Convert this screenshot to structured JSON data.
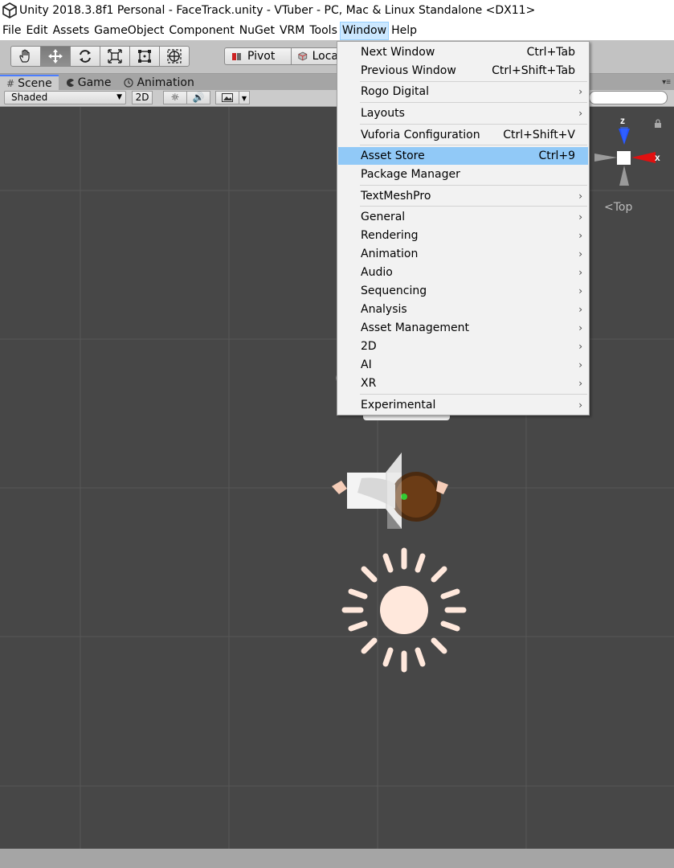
{
  "window": {
    "title": "Unity 2018.3.8f1 Personal - FaceTrack.unity - VTuber - PC, Mac & Linux Standalone <DX11>"
  },
  "menubar": {
    "items": [
      "File",
      "Edit",
      "Assets",
      "GameObject",
      "Component",
      "NuGet",
      "VRM",
      "Tools",
      "Window",
      "Help"
    ],
    "active": "Window"
  },
  "toolbar": {
    "tools": [
      "hand-tool",
      "move-tool",
      "rotate-tool",
      "scale-tool",
      "rect-tool",
      "transform-tool"
    ],
    "selected_tool": "move-tool",
    "pivot_label": "Pivot",
    "local_label": "Loca"
  },
  "tabs": [
    {
      "label": "Scene",
      "icon": "#"
    },
    {
      "label": "Game",
      "icon": "game-icon"
    },
    {
      "label": "Animation",
      "icon": "clock-icon"
    }
  ],
  "scene_controls": {
    "draw_mode": "Shaded",
    "mode_2d": "2D"
  },
  "window_menu": {
    "items": [
      {
        "label": "Next Window",
        "shortcut": "Ctrl+Tab"
      },
      {
        "label": "Previous Window",
        "shortcut": "Ctrl+Shift+Tab"
      },
      {
        "label": "Rogo Digital",
        "submenu": true
      },
      {
        "label": "Layouts",
        "submenu": true
      },
      {
        "label": "Vuforia Configuration",
        "shortcut": "Ctrl+Shift+V"
      },
      {
        "label": "Asset Store",
        "shortcut": "Ctrl+9",
        "highlighted": true
      },
      {
        "label": "Package Manager"
      },
      {
        "label": "TextMeshPro",
        "submenu": true
      },
      {
        "label": "General",
        "submenu": true
      },
      {
        "label": "Rendering",
        "submenu": true
      },
      {
        "label": "Animation",
        "submenu": true
      },
      {
        "label": "Audio",
        "submenu": true
      },
      {
        "label": "Sequencing",
        "submenu": true
      },
      {
        "label": "Analysis",
        "submenu": true
      },
      {
        "label": "Asset Management",
        "submenu": true
      },
      {
        "label": "2D",
        "submenu": true
      },
      {
        "label": "AI",
        "submenu": true
      },
      {
        "label": "XR",
        "submenu": true
      },
      {
        "label": "Experimental",
        "submenu": true
      }
    ]
  },
  "gizmo": {
    "z_label": "z",
    "x_label": "x",
    "view_label": "Top",
    "colors": {
      "z": "#1f4fff",
      "x": "#e01010"
    }
  },
  "colors": {
    "scene_bg": "#474747",
    "grid": "#565656",
    "menu_highlight": "#91c9f7",
    "tab_accent": "#4c7eff",
    "sun_icon": "#ffe8dc"
  }
}
